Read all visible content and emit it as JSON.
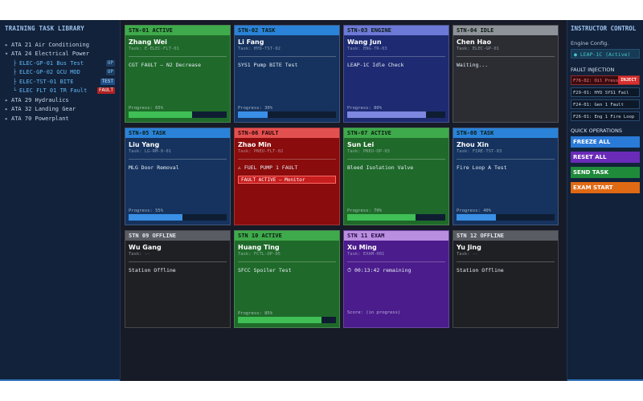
{
  "library": {
    "title": "TRAINING TASK LIBRARY",
    "items": [
      {
        "bullet": "▸",
        "text": "ATA 21  Air Conditioning",
        "child": false,
        "badge": ""
      },
      {
        "bullet": "▾",
        "text": "ATA 24  Electrical Power",
        "child": false,
        "badge": ""
      },
      {
        "bullet": "├",
        "text": "ELEC-GP-01  Bus Test",
        "child": true,
        "badge": "OP",
        "badge_type": "op"
      },
      {
        "bullet": "├",
        "text": "ELEC-GP-02  GCU MOD",
        "child": true,
        "badge": "OP",
        "badge_type": "op"
      },
      {
        "bullet": "├",
        "text": "ELEC-TST-01  BITE",
        "child": true,
        "badge": "TEST",
        "badge_type": "test"
      },
      {
        "bullet": "└",
        "text": "ELEC FLT 01  TR Fault",
        "child": true,
        "badge": "FAULT",
        "badge_type": "fault"
      },
      {
        "bullet": "▸",
        "text": "ATA 29  Hydraulics",
        "child": false,
        "badge": ""
      },
      {
        "bullet": "▸",
        "text": "ATA 32  Landing Gear",
        "child": false,
        "badge": ""
      },
      {
        "bullet": "▸",
        "text": "ATA 70  Powerplant",
        "child": false,
        "badge": ""
      }
    ]
  },
  "stations": [
    {
      "header": "STN-01 ACTIVE",
      "status": "active",
      "name": "Zhang Wei",
      "task": "Task: E-ELEC-FLT-01",
      "desc": "CGT FAULT — N2 Decrease",
      "progress_label": "Progress: 65%",
      "progress": 65,
      "bar_color": "#3fbf55"
    },
    {
      "header": "STN-02 TASK",
      "status": "task",
      "name": "Li Fang",
      "task": "Task: HYD-TST-02",
      "desc": "SYS1 Pump BITE Test",
      "progress_label": "Progress: 30%",
      "progress": 30,
      "bar_color": "#3a8fe6"
    },
    {
      "header": "STN-03 ENGINE",
      "status": "engine",
      "name": "Wang Jun",
      "task": "Task: ENG-TR-03",
      "desc": "LEAP-1C Idle Check",
      "progress_label": "Progress: 80%",
      "progress": 80,
      "bar_color": "#7d87e0"
    },
    {
      "header": "STN-04 IDLE",
      "status": "idle",
      "name": "Chen Hao",
      "task": "Task: ELEC-GP-01",
      "desc": "Waiting...",
      "progress_label": "",
      "progress": null,
      "bar_color": ""
    },
    {
      "header": "STN-05 TASK",
      "status": "task",
      "name": "Liu Yang",
      "task": "Task: LG-RM-0-01",
      "desc": "MLG Door Removal",
      "progress_label": "Progress: 55%",
      "progress": 55,
      "bar_color": "#3a8fe6"
    },
    {
      "header": "STN-06 FAULT",
      "status": "fault",
      "name": "Zhao Min",
      "task": "Task: PNEU-FLT-02",
      "desc": "⚠ FUEL PUMP 1 FAULT",
      "note": "FAULT ACTIVE — Monitor",
      "progress_label": "",
      "progress": null,
      "bar_color": ""
    },
    {
      "header": "STN-07 ACTIVE",
      "status": "active",
      "name": "Sun Lei",
      "task": "Task: PNEU-OP-03",
      "desc": "Bleed Isolation Valve",
      "progress_label": "Progress: 70%",
      "progress": 70,
      "bar_color": "#3fbf55"
    },
    {
      "header": "STN-08 TASK",
      "status": "task",
      "name": "Zhou Xin",
      "task": "Task: FIRE-TST-03",
      "desc": "Fire Loop A Test",
      "progress_label": "Progress: 40%",
      "progress": 40,
      "bar_color": "#3a8fe6"
    },
    {
      "header": "STN 09 OFFLINE",
      "status": "offline",
      "name": "Wu Gang",
      "task": "Task: --",
      "desc": "Station Offline",
      "progress_label": "",
      "progress": null,
      "bar_color": ""
    },
    {
      "header": "STN 10 ACTIVE",
      "status": "active",
      "name": "Huang Ting",
      "task": "Task: FCTL-OP-05",
      "desc": "SFCC Spoiler Test",
      "progress_label": "Progress: 85%",
      "progress": 85,
      "bar_color": "#3fbf55"
    },
    {
      "header": "STN 11 EXAM",
      "status": "exam",
      "name": "Xu Ming",
      "task": "Task: EXAM-001",
      "desc": "⏱ 00:13:42 remaining",
      "score": "Score:   (in progress)",
      "progress_label": "",
      "progress": null,
      "bar_color": ""
    },
    {
      "header": "STN 12 OFFLINE",
      "status": "offline",
      "name": "Yu Jing",
      "task": "Task: --",
      "desc": "Station Offline",
      "progress_label": "",
      "progress": null,
      "bar_color": ""
    }
  ],
  "instructor": {
    "title": "INSTRUCTOR CONTROL",
    "engine_label": "Engine Config.",
    "engine_value": "● LEAP-1C (Active)",
    "fault_title": "FAULT INJECTION",
    "faults": [
      {
        "text": "F76-02: Oil Press Low",
        "armed": true,
        "action": "INJECT"
      },
      {
        "text": "F29-01: HYD SYS1 Fail",
        "armed": false,
        "action": ""
      },
      {
        "text": "F24-01: Gen 1 Fault",
        "armed": false,
        "action": ""
      },
      {
        "text": "F26-01: Eng 1 Fire Loop",
        "armed": false,
        "action": ""
      }
    ],
    "ops_title": "QUICK OPERATIONS",
    "ops": [
      {
        "label": "FREEZE ALL",
        "kind": "freeze"
      },
      {
        "label": "RESET ALL",
        "kind": "reset"
      },
      {
        "label": "SEND TASK",
        "kind": "send"
      },
      {
        "label": "EXAM START",
        "kind": "exam"
      }
    ]
  }
}
